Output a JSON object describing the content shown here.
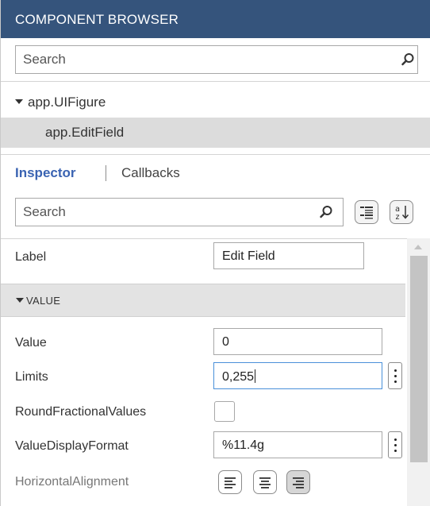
{
  "component_browser": {
    "title": "COMPONENT BROWSER",
    "search_placeholder": "Search",
    "tree": {
      "root_label": "app.UIFigure",
      "child_label": "app.EditField"
    }
  },
  "inspector": {
    "tabs": {
      "inspector_label": "Inspector",
      "callbacks_label": "Callbacks"
    },
    "search_placeholder": "Search",
    "properties": {
      "label_name": "Label",
      "label_value": "Edit Field",
      "section_value": "VALUE",
      "value_name": "Value",
      "value_value": "0",
      "limits_name": "Limits",
      "limits_value": "0,255",
      "round_name": "RoundFractionalValues",
      "display_format_name": "ValueDisplayFormat",
      "display_format_value": "%11.4g",
      "horizontal_alignment_name": "HorizontalAlignment",
      "horizontal_alignment_selected": "right"
    }
  },
  "icons": {
    "search": "search-icon",
    "categorized_view": "categorized-list-icon",
    "alphabetical_sort": "sort-az-icon",
    "align_left": "align-left-icon",
    "align_center": "align-center-icon",
    "align_right": "align-right-icon"
  },
  "colors": {
    "header_bg": "#35547c",
    "tab_active": "#3a63b2",
    "selected_row": "#dcdcdc",
    "focus_border": "#4a90d9"
  }
}
